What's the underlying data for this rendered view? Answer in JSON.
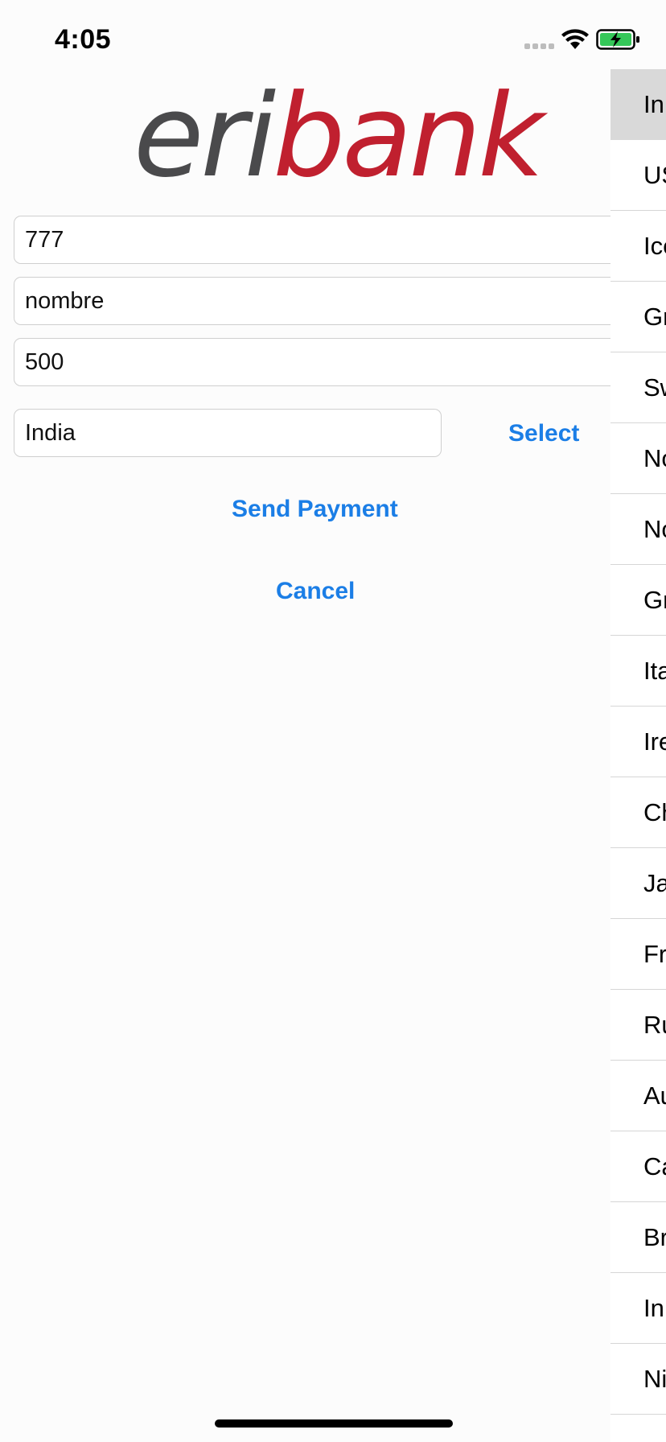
{
  "status_bar": {
    "time": "4:05"
  },
  "logo": {
    "part1": "eri",
    "part2": "bank",
    "colors": {
      "eri": "#4a4a4c",
      "bank": "#c0202f"
    }
  },
  "form": {
    "phone_value": "777",
    "name_value": "nombre",
    "amount_value": "500",
    "country_value": "India",
    "select_label": "Select",
    "send_label": "Send Payment",
    "cancel_label": "Cancel"
  },
  "accent_color": "#1b7ee6",
  "country_list": {
    "items": [
      "In",
      "US",
      "Ice",
      "Gr",
      "Sw",
      "No",
      "No",
      "Gr",
      "Ita",
      "Ire",
      "Ch",
      "Ja",
      "Fr",
      "Ru",
      "Au",
      "Ca",
      "Br",
      "In",
      "Ni"
    ],
    "selected_index": 0
  }
}
